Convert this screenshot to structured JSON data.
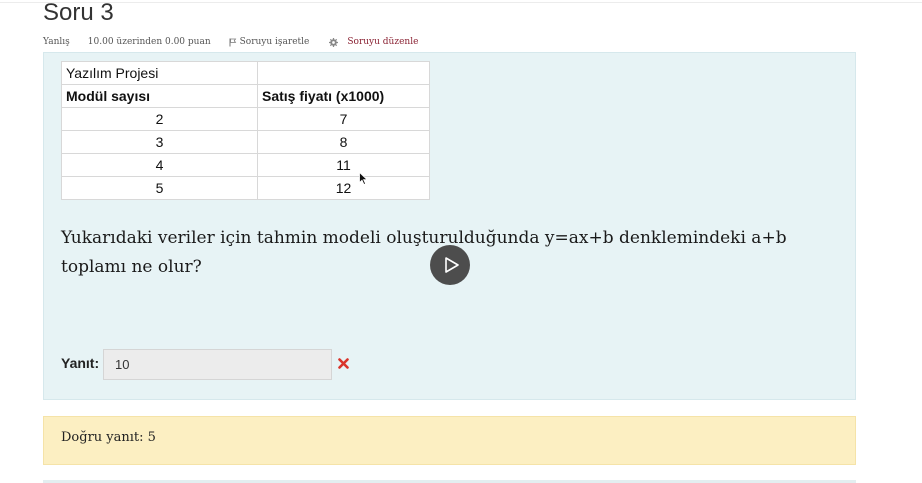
{
  "question": {
    "title": "Soru 3",
    "status": "Yanlış",
    "grade": "10.00 üzerinden 0.00 puan",
    "flag_label": "Soruyu işaretle",
    "edit_label": "Soruyu düzenle",
    "table": {
      "title": "Yazılım Projesi",
      "headers": [
        "Modül sayısı",
        "Satış fiyatı (x1000)"
      ],
      "rows": [
        [
          "2",
          "7"
        ],
        [
          "3",
          "8"
        ],
        [
          "4",
          "11"
        ],
        [
          "5",
          "12"
        ]
      ]
    },
    "text": "Yukarıdaki veriler için tahmin modeli oluşturulduğunda y=ax+b denklemindeki a+b toplamı ne olur?",
    "answer_label": "Yanıt:",
    "answer_value": "10",
    "feedback": "Doğru yanıt: 5"
  },
  "colors": {
    "content_bg": "#e7f3f5",
    "feedback_bg": "#fcefc2",
    "wrong_mark": "#d9342b",
    "edit_link": "#8a2233"
  },
  "icons": {
    "flag": "flag-icon",
    "edit": "gear-icon",
    "wrong": "cross-icon",
    "play": "play-icon",
    "cursor": "cursor-icon"
  }
}
